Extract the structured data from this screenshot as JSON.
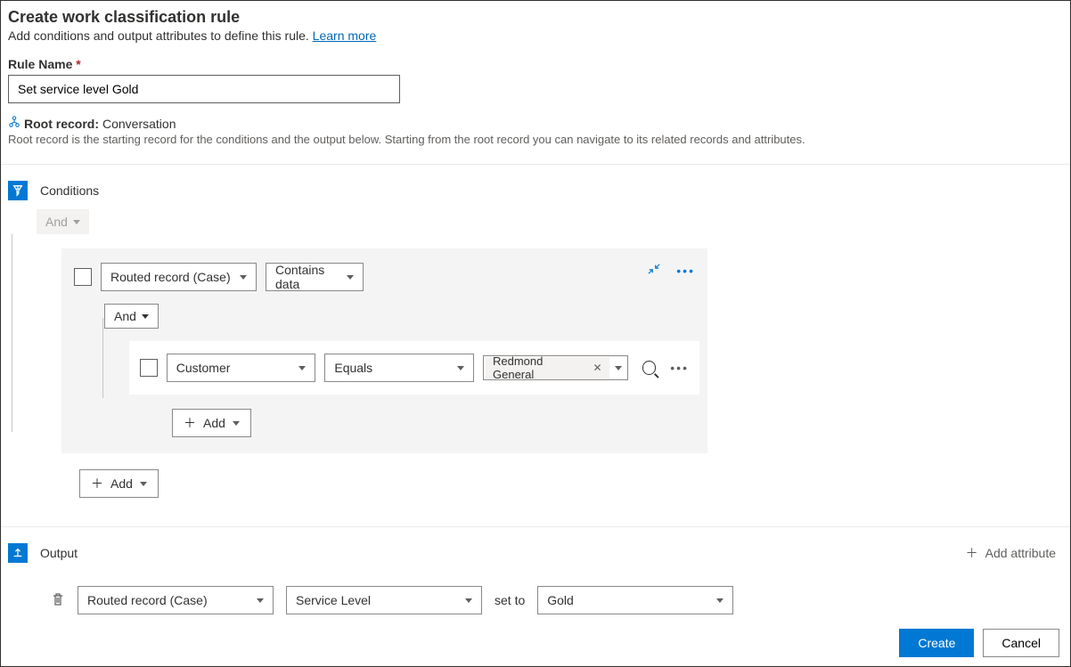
{
  "header": {
    "title": "Create work classification rule",
    "subtitle_text": "Add conditions and output attributes to define this rule. ",
    "learn_more": "Learn more"
  },
  "rule_name": {
    "label": "Rule Name",
    "value": "Set service level Gold"
  },
  "root_record": {
    "label": "Root record:",
    "value": "Conversation",
    "hint": "Root record is the starting record for the conditions and the output below. Starting from the root record you can navigate to its related records and attributes."
  },
  "conditions": {
    "title": "Conditions",
    "top_and": "And",
    "group": {
      "field": "Routed record (Case)",
      "operator": "Contains data",
      "inner_and": "And",
      "nested": {
        "field": "Customer",
        "operator": "Equals",
        "value_tag": "Redmond General"
      },
      "add_inner": "Add"
    },
    "add_outer": "Add"
  },
  "output": {
    "title": "Output",
    "add_attribute": "Add attribute",
    "row": {
      "record": "Routed record (Case)",
      "attribute": "Service Level",
      "set_to": "set to",
      "value": "Gold"
    }
  },
  "footer": {
    "create": "Create",
    "cancel": "Cancel"
  }
}
